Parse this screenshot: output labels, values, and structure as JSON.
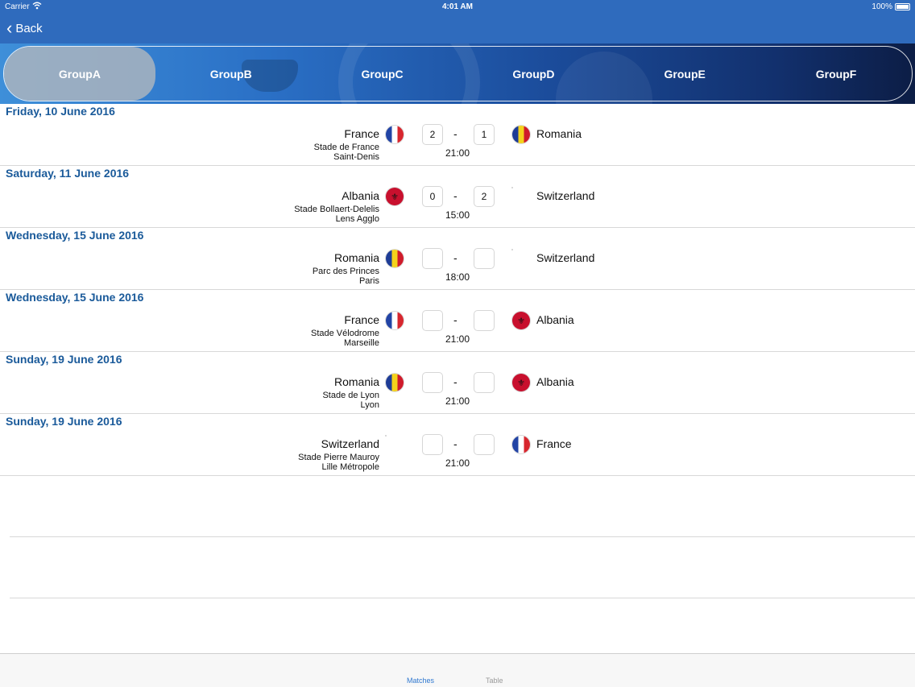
{
  "status_bar": {
    "carrier": "Carrier",
    "time": "4:01 AM",
    "battery": "100%"
  },
  "nav": {
    "back_label": "Back"
  },
  "groups": [
    "GroupA",
    "GroupB",
    "GroupC",
    "GroupD",
    "GroupE",
    "GroupF"
  ],
  "selected_group": "GroupA",
  "matches": [
    {
      "date": "Friday, 10 June 2016",
      "home": "France",
      "home_flag": "france-flag",
      "home_score": "2",
      "away_score": "1",
      "away": "Romania",
      "away_flag": "romania-flag",
      "stadium": "Stade de France",
      "city": "Saint-Denis",
      "time": "21:00"
    },
    {
      "date": "Saturday, 11 June 2016",
      "home": "Albania",
      "home_flag": "albania-flag",
      "home_score": "0",
      "away_score": "2",
      "away": "Switzerland",
      "away_flag": "switzerland-flag",
      "stadium": "Stade Bollaert-Delelis",
      "city": "Lens Agglo",
      "time": "15:00"
    },
    {
      "date": "Wednesday, 15 June 2016",
      "home": "Romania",
      "home_flag": "romania-flag",
      "home_score": "",
      "away_score": "",
      "away": "Switzerland",
      "away_flag": "switzerland-flag",
      "stadium": "Parc des Princes",
      "city": "Paris",
      "time": "18:00"
    },
    {
      "date": "Wednesday, 15 June 2016",
      "home": "France",
      "home_flag": "france-flag",
      "home_score": "",
      "away_score": "",
      "away": "Albania",
      "away_flag": "albania-flag",
      "stadium": "Stade Vélodrome",
      "city": "Marseille",
      "time": "21:00"
    },
    {
      "date": "Sunday, 19 June 2016",
      "home": "Romania",
      "home_flag": "romania-flag",
      "home_score": "",
      "away_score": "",
      "away": "Albania",
      "away_flag": "albania-flag",
      "stadium": "Stade de Lyon",
      "city": "Lyon",
      "time": "21:00"
    },
    {
      "date": "Sunday, 19 June 2016",
      "home": "Switzerland",
      "home_flag": "switzerland-flag",
      "home_score": "",
      "away_score": "",
      "away": "France",
      "away_flag": "france-flag",
      "stadium": "Stade Pierre Mauroy",
      "city": "Lille Métropole",
      "time": "21:00"
    }
  ],
  "tabbar": {
    "matches_label": "Matches",
    "table_label": "Table",
    "active": "Matches"
  },
  "colors": {
    "nav_blue": "#2f6bbd",
    "date_blue": "#1a5a9a",
    "tab_active": "#2f78d0"
  }
}
